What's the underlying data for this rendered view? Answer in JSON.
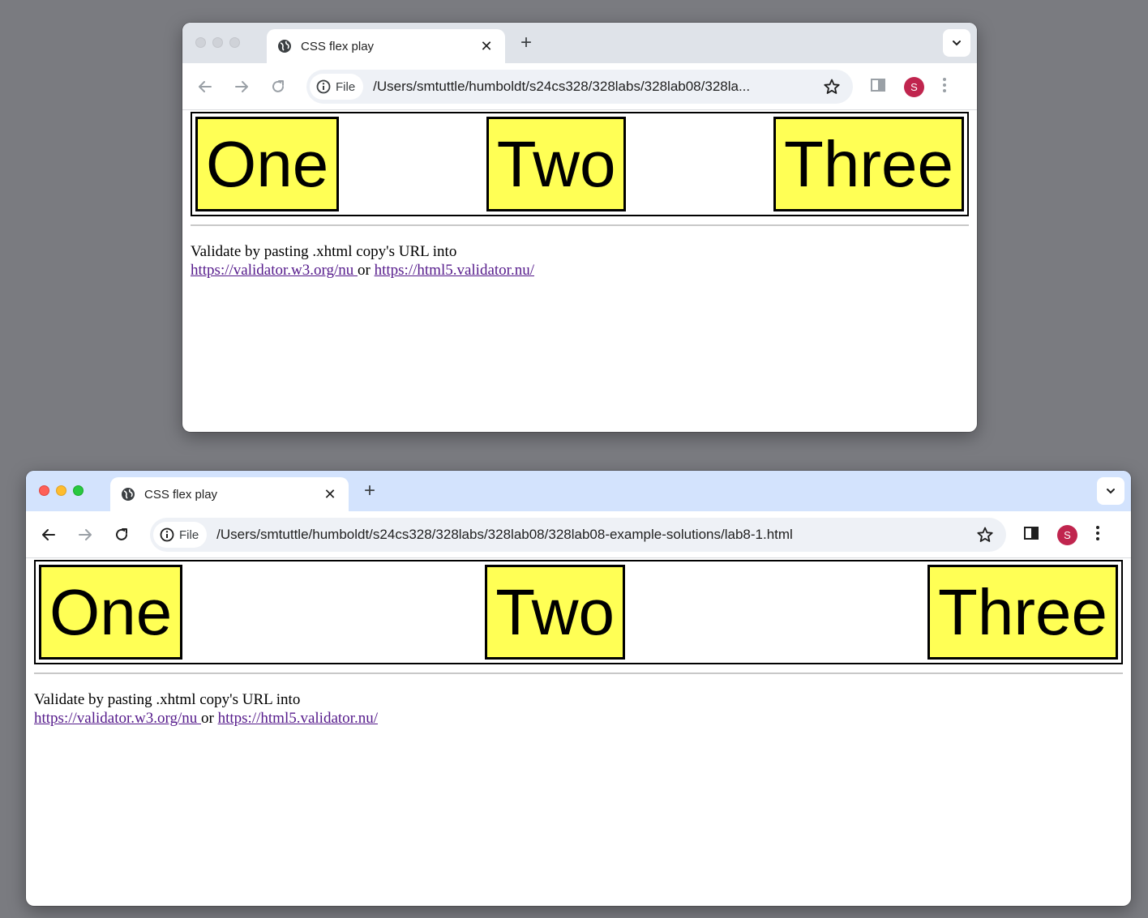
{
  "windows": [
    {
      "tab_title": "CSS flex play",
      "new_tab_icon": "+",
      "address_chip": "File",
      "url": "/Users/smtuttle/humboldt/s24cs328/328labs/328lab08/328la...",
      "avatar_letter": "S",
      "boxes": [
        "One",
        "Two",
        "Three"
      ],
      "validate_text": "Validate by pasting .xhtml copy's URL into",
      "link1": "https://validator.w3.org/nu ",
      "link_sep": "or",
      "link2": "https://html5.validator.nu/"
    },
    {
      "tab_title": "CSS flex play",
      "new_tab_icon": "+",
      "address_chip": "File",
      "url": "/Users/smtuttle/humboldt/s24cs328/328labs/328lab08/328lab08-example-solutions/lab8-1.html",
      "avatar_letter": "S",
      "boxes": [
        "One",
        "Two",
        "Three"
      ],
      "validate_text": "Validate by pasting .xhtml copy's URL into",
      "link1": "https://validator.w3.org/nu ",
      "link_sep": "or",
      "link2": "https://html5.validator.nu/"
    }
  ],
  "colors": {
    "desktop": "#7a7b80",
    "box_fill": "#ffff55",
    "link": "#551a8b",
    "avatar": "#c0254e",
    "front_tabstrip": "#d3e3fd",
    "back_tabstrip": "#dfe3e9"
  },
  "icons": [
    "globe-icon",
    "close-icon",
    "chevron-down-icon",
    "back-arrow-icon",
    "forward-arrow-icon",
    "reload-icon",
    "info-icon",
    "star-icon",
    "side-panel-icon",
    "kebab-menu-icon"
  ]
}
